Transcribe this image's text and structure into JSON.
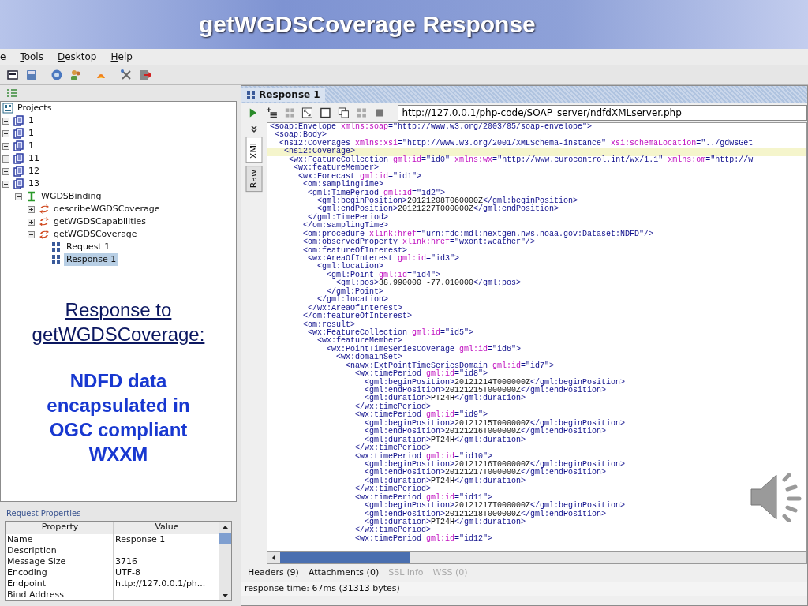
{
  "slide_title": "getWGDSCoverage Response",
  "menu": [
    {
      "label": "e",
      "mnemonic": false
    },
    {
      "label": "Tools",
      "mnemonic": true
    },
    {
      "label": "Desktop",
      "mnemonic": true
    },
    {
      "label": "Help",
      "mnemonic": true
    }
  ],
  "navigator": {
    "label": "Projects",
    "kind": "root",
    "selected": false,
    "children": [
      {
        "label": "1",
        "kind": "project",
        "expanded": false,
        "selected": false
      },
      {
        "label": "1",
        "kind": "project",
        "expanded": false,
        "selected": false
      },
      {
        "label": "1",
        "kind": "project",
        "expanded": false,
        "selected": false
      },
      {
        "label": "11",
        "kind": "project",
        "expanded": false,
        "selected": false
      },
      {
        "label": "12",
        "kind": "project",
        "expanded": false,
        "selected": false
      },
      {
        "label": "13",
        "kind": "project",
        "expanded": true,
        "selected": false,
        "children": [
          {
            "label": "WGDSBinding",
            "kind": "interface",
            "expanded": true,
            "selected": false,
            "children": [
              {
                "label": "describeWGDSCoverage",
                "kind": "operation",
                "expanded": false,
                "selected": false
              },
              {
                "label": "getWGDSCapabilities",
                "kind": "operation",
                "expanded": false,
                "selected": false
              },
              {
                "label": "getWGDSCoverage",
                "kind": "operation",
                "expanded": true,
                "selected": false,
                "children": [
                  {
                    "label": "Request 1",
                    "kind": "request",
                    "selected": false
                  },
                  {
                    "label": "Response 1",
                    "kind": "request",
                    "selected": true
                  }
                ]
              }
            ]
          }
        ]
      }
    ]
  },
  "slide_text": {
    "heading": "Response to getWGDSCoverage:",
    "body": "NDFD data encapsulated in OGC compliant WXXM"
  },
  "properties": {
    "title": "Request Properties",
    "columns": [
      "Property",
      "Value"
    ],
    "rows": [
      {
        "property": "Name",
        "value": "Response 1"
      },
      {
        "property": "Description"
      },
      {
        "property": "Message Size",
        "value": "3716"
      },
      {
        "property": "Encoding",
        "value": "UTF-8"
      },
      {
        "property": "Endpoint",
        "value": "http://127.0.0.1/ph..."
      },
      {
        "property": "Bind Address"
      }
    ]
  },
  "editor": {
    "title": "Response 1",
    "endpoint": "http://127.0.0.1/php-code/SOAP_server/ndfdXMLserver.php",
    "side_tabs": [
      {
        "label": "XML",
        "selected": true
      },
      {
        "label": "Raw",
        "selected": false
      }
    ],
    "lines": [
      {
        "code": "<soap:Envelope xmlns:soap=\"http://www.w3.org/2003/05/soap-envelope\">",
        "highlighted": false
      },
      {
        "code": " <soap:Body>",
        "highlighted": false
      },
      {
        "code": "  <ns12:Coverages xmlns:xsi=\"http://www.w3.org/2001/XMLSchema-instance\" xsi:schemaLocation=\"../gdwsGet",
        "highlighted": false
      },
      {
        "code": "   <ns12:Coverage>",
        "highlighted": true
      },
      {
        "code": "    <wx:FeatureCollection gml:id=\"id0\" xmlns:wx=\"http://www.eurocontrol.int/wx/1.1\" xmlns:om=\"http://w",
        "highlighted": false
      },
      {
        "code": "     <wx:featureMember>",
        "highlighted": false
      },
      {
        "code": "      <wx:Forecast gml:id=\"id1\">",
        "highlighted": false
      },
      {
        "code": "       <om:samplingTime>",
        "highlighted": false
      },
      {
        "code": "        <gml:TimePeriod gml:id=\"id2\">",
        "highlighted": false
      },
      {
        "code": "          <gml:beginPosition>20121208T060000Z</gml:beginPosition>",
        "highlighted": false
      },
      {
        "code": "          <gml:endPosition>20121227T000000Z</gml:endPosition>",
        "highlighted": false
      },
      {
        "code": "        </gml:TimePeriod>",
        "highlighted": false
      },
      {
        "code": "       </om:samplingTime>",
        "highlighted": false
      },
      {
        "code": "       <om:procedure xlink:href=\"urn:fdc:mdl:nextgen.nws.noaa.gov:Dataset:NDFD\"/>",
        "highlighted": false
      },
      {
        "code": "       <om:observedProperty xlink:href=\"wxont:weather\"/>",
        "highlighted": false
      },
      {
        "code": "       <om:featureOfInterest>",
        "highlighted": false
      },
      {
        "code": "        <wx:AreaOfInterest gml:id=\"id3\">",
        "highlighted": false
      },
      {
        "code": "          <gml:location>",
        "highlighted": false
      },
      {
        "code": "            <gml:Point gml:id=\"id4\">",
        "highlighted": false
      },
      {
        "code": "              <gml:pos>38.990000 -77.010000</gml:pos>",
        "highlighted": false
      },
      {
        "code": "            </gml:Point>",
        "highlighted": false
      },
      {
        "code": "          </gml:location>",
        "highlighted": false
      },
      {
        "code": "        </wx:AreaOfInterest>",
        "highlighted": false
      },
      {
        "code": "       </om:featureOfInterest>",
        "highlighted": false
      },
      {
        "code": "       <om:result>",
        "highlighted": false
      },
      {
        "code": "        <wx:FeatureCollection gml:id=\"id5\">",
        "highlighted": false
      },
      {
        "code": "          <wx:featureMember>",
        "highlighted": false
      },
      {
        "code": "            <wx:PointTimeSeriesCoverage gml:id=\"id6\">",
        "highlighted": false
      },
      {
        "code": "              <wx:domainSet>",
        "highlighted": false
      },
      {
        "code": "                <nawx:ExtPointTimeSeriesDomain gml:id=\"id7\">",
        "highlighted": false
      },
      {
        "code": "                  <wx:timePeriod gml:id=\"id8\">",
        "highlighted": false
      },
      {
        "code": "                    <gml:beginPosition>20121214T000000Z</gml:beginPosition>",
        "highlighted": false
      },
      {
        "code": "                    <gml:endPosition>20121215T000000Z</gml:endPosition>",
        "highlighted": false
      },
      {
        "code": "                    <gml:duration>PT24H</gml:duration>",
        "highlighted": false
      },
      {
        "code": "                  </wx:timePeriod>",
        "highlighted": false
      },
      {
        "code": "                  <wx:timePeriod gml:id=\"id9\">",
        "highlighted": false
      },
      {
        "code": "                    <gml:beginPosition>20121215T000000Z</gml:beginPosition>",
        "highlighted": false
      },
      {
        "code": "                    <gml:endPosition>20121216T000000Z</gml:endPosition>",
        "highlighted": false
      },
      {
        "code": "                    <gml:duration>PT24H</gml:duration>",
        "highlighted": false
      },
      {
        "code": "                  </wx:timePeriod>",
        "highlighted": false
      },
      {
        "code": "                  <wx:timePeriod gml:id=\"id10\">",
        "highlighted": false
      },
      {
        "code": "                    <gml:beginPosition>20121216T000000Z</gml:beginPosition>",
        "highlighted": false
      },
      {
        "code": "                    <gml:endPosition>20121217T000000Z</gml:endPosition>",
        "highlighted": false
      },
      {
        "code": "                    <gml:duration>PT24H</gml:duration>",
        "highlighted": false
      },
      {
        "code": "                  </wx:timePeriod>",
        "highlighted": false
      },
      {
        "code": "                  <wx:timePeriod gml:id=\"id11\">",
        "highlighted": false
      },
      {
        "code": "                    <gml:beginPosition>20121217T000000Z</gml:beginPosition>",
        "highlighted": false
      },
      {
        "code": "                    <gml:endPosition>20121218T000000Z</gml:endPosition>",
        "highlighted": false
      },
      {
        "code": "                    <gml:duration>PT24H</gml:duration>",
        "highlighted": false
      },
      {
        "code": "                  </wx:timePeriod>",
        "highlighted": false
      },
      {
        "code": "                  <wx:timePeriod gml:id=\"id12\">",
        "highlighted": false
      }
    ],
    "bottom_tabs": [
      {
        "label": "Headers (9)",
        "disabled": false
      },
      {
        "label": "Attachments (0)",
        "disabled": false
      },
      {
        "label": "SSL Info",
        "disabled": true
      },
      {
        "label": "WSS (0)",
        "disabled": true
      }
    ],
    "status": "response time: 67ms (31313 bytes)"
  }
}
